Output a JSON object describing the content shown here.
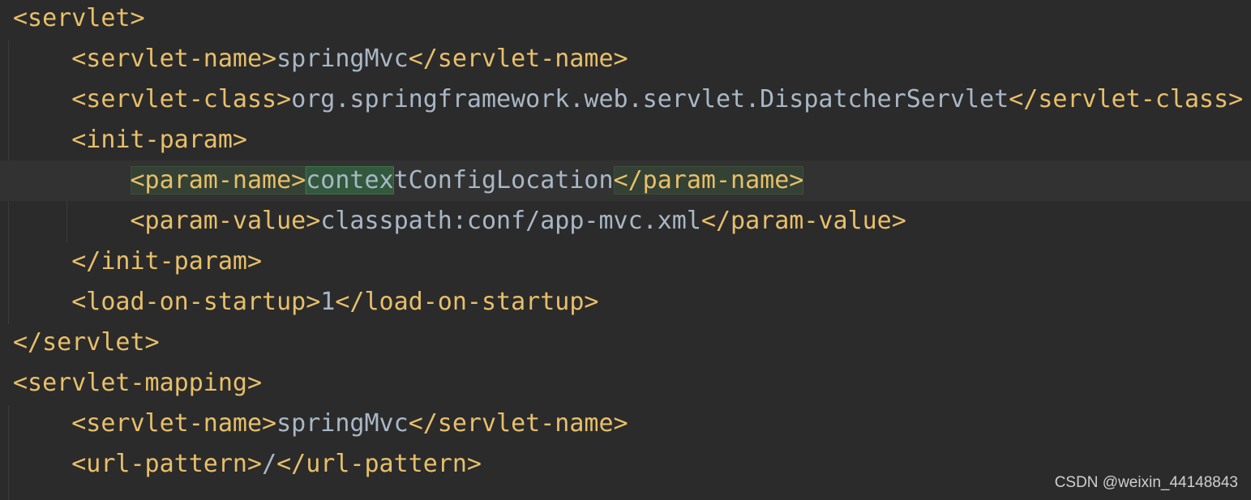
{
  "code": {
    "lines": [
      {
        "indent": "",
        "parts": [
          {
            "t": "tag",
            "v": "<servlet>"
          }
        ]
      },
      {
        "indent": "    ",
        "parts": [
          {
            "t": "tag",
            "v": "<servlet-name>"
          },
          {
            "t": "txt",
            "v": "springMvc"
          },
          {
            "t": "tag",
            "v": "</servlet-name>"
          }
        ]
      },
      {
        "indent": "    ",
        "parts": [
          {
            "t": "tag",
            "v": "<servlet-class>"
          },
          {
            "t": "txt",
            "v": "org.springframework.web.servlet.DispatcherServlet"
          },
          {
            "t": "tag",
            "v": "</servlet-class>"
          }
        ]
      },
      {
        "indent": "    ",
        "parts": [
          {
            "t": "tag",
            "v": "<init-param>"
          }
        ]
      },
      {
        "indent": "        ",
        "current": true,
        "parts": [
          {
            "t": "tag",
            "v": "<param-name>",
            "hl": "tag"
          },
          {
            "t": "txt",
            "v": "contex",
            "hl": "word"
          },
          {
            "t": "txt",
            "v": "tConfigLocation"
          },
          {
            "t": "tag",
            "v": "</param-name>",
            "hl": "tag"
          }
        ]
      },
      {
        "indent": "        ",
        "parts": [
          {
            "t": "tag",
            "v": "<param-value>"
          },
          {
            "t": "txt",
            "v": "classpath:conf/app-mvc.xml"
          },
          {
            "t": "tag",
            "v": "</param-value>"
          }
        ]
      },
      {
        "indent": "    ",
        "parts": [
          {
            "t": "tag",
            "v": "</init-param>"
          }
        ]
      },
      {
        "indent": "    ",
        "parts": [
          {
            "t": "tag",
            "v": "<load-on-startup>"
          },
          {
            "t": "txt",
            "v": "1"
          },
          {
            "t": "tag",
            "v": "</load-on-startup>"
          }
        ]
      },
      {
        "indent": "",
        "parts": [
          {
            "t": "tag",
            "v": "</servlet>"
          }
        ]
      },
      {
        "indent": "",
        "parts": [
          {
            "t": "tag",
            "v": "<servlet-mapping>"
          }
        ]
      },
      {
        "indent": "    ",
        "parts": [
          {
            "t": "tag",
            "v": "<servlet-name>"
          },
          {
            "t": "txt",
            "v": "springMvc"
          },
          {
            "t": "tag",
            "v": "</servlet-name>"
          }
        ]
      },
      {
        "indent": "    ",
        "parts": [
          {
            "t": "tag",
            "v": "<url-pattern>"
          },
          {
            "t": "txt",
            "v": "/"
          },
          {
            "t": "tag",
            "v": "</url-pattern>"
          }
        ]
      }
    ]
  },
  "watermark": "CSDN @weixin_44148843",
  "colors": {
    "background": "#2b2b2b",
    "tag": "#e8bf6a",
    "text": "#a9b7c6",
    "current_line": "#323232",
    "match_highlight": "#32593d"
  }
}
